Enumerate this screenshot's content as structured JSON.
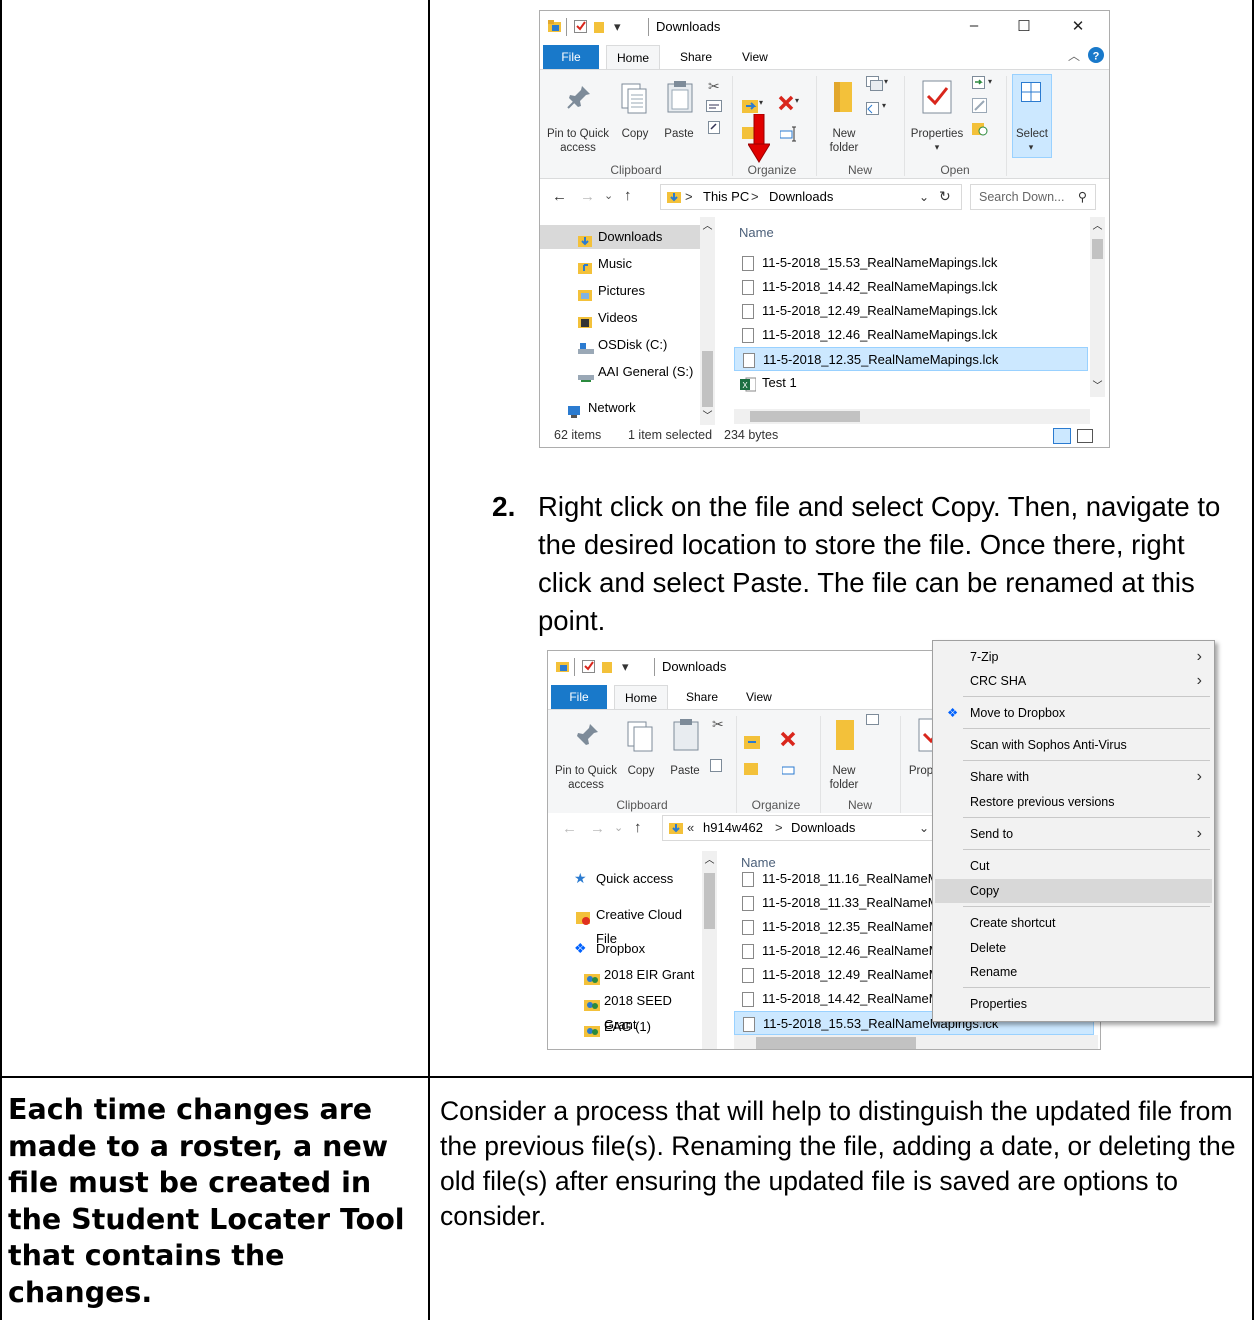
{
  "doc": {
    "step_number": "2.",
    "step_text": "Right click on the file and select Copy. Then, navigate to the desired location to store the file. Once there, right click and select Paste. The file can be renamed at this point.",
    "left_bold": "Each time changes are made to a roster, a new file must be created in the Student Locater Tool that contains the changes.",
    "right_text": "Consider a process that will help to distinguish the updated file from the previous file(s). Renaming the file, adding a date, or deleting the old file(s) after ensuring the updated file is saved are options to consider."
  },
  "window1": {
    "title": "Downloads",
    "tabs": [
      "File",
      "Home",
      "Share",
      "View"
    ],
    "ribbon": {
      "pin": "Pin to Quick access",
      "copy": "Copy",
      "paste": "Paste",
      "new_folder": "New folder",
      "properties": "Properties",
      "select": "Select",
      "groups": [
        "Clipboard",
        "Organize",
        "New",
        "Open"
      ]
    },
    "address": [
      "This PC",
      "Downloads"
    ],
    "search_placeholder": "Search Down...",
    "nav": [
      "Downloads",
      "Music",
      "Pictures",
      "Videos",
      "OSDisk (C:)",
      "AAI General (S:)",
      "Network"
    ],
    "column": "Name",
    "files": [
      "11-5-2018_15.53_RealNameMapings.lck",
      "11-5-2018_14.42_RealNameMapings.lck",
      "11-5-2018_12.49_RealNameMapings.lck",
      "11-5-2018_12.46_RealNameMapings.lck",
      "11-5-2018_12.35_RealNameMapings.lck",
      "Test 1"
    ],
    "status": {
      "count": "62 items",
      "selected": "1 item selected",
      "size": "234 bytes"
    }
  },
  "window2": {
    "title": "Downloads",
    "tabs": [
      "File",
      "Home",
      "Share",
      "View"
    ],
    "ribbon": {
      "pin": "Pin to Quick access",
      "copy": "Copy",
      "paste": "Paste",
      "new_folder": "New folder",
      "properties": "Prop",
      "groups": [
        "Clipboard",
        "Organize",
        "New"
      ]
    },
    "address": [
      "h914w462",
      "Downloads"
    ],
    "nav": [
      "Quick access",
      "Creative Cloud File",
      "Dropbox",
      "2018 EIR Grant",
      "2018 SEED Grant",
      "EAG (1)"
    ],
    "column": "Name",
    "files": [
      "11-5-2018_11.16_RealNameM",
      "11-5-2018_11.33_RealNameM",
      "11-5-2018_12.35_RealNameM",
      "11-5-2018_12.46_RealNameM",
      "11-5-2018_12.49_RealNameM",
      "11-5-2018_14.42_RealNameM",
      "11-5-2018_15.53_RealNameMapings.lck"
    ]
  },
  "context_menu": {
    "items": [
      "7-Zip",
      "CRC SHA",
      "Move to Dropbox",
      "Scan with Sophos Anti-Virus",
      "Share with",
      "Restore previous versions",
      "Send to",
      "Cut",
      "Copy",
      "Create shortcut",
      "Delete",
      "Rename",
      "Properties"
    ],
    "highlighted": "Copy"
  },
  "colors": {
    "file_tab": "#1979ca",
    "selection": "#cce8ff",
    "arrow": "#e00000"
  }
}
